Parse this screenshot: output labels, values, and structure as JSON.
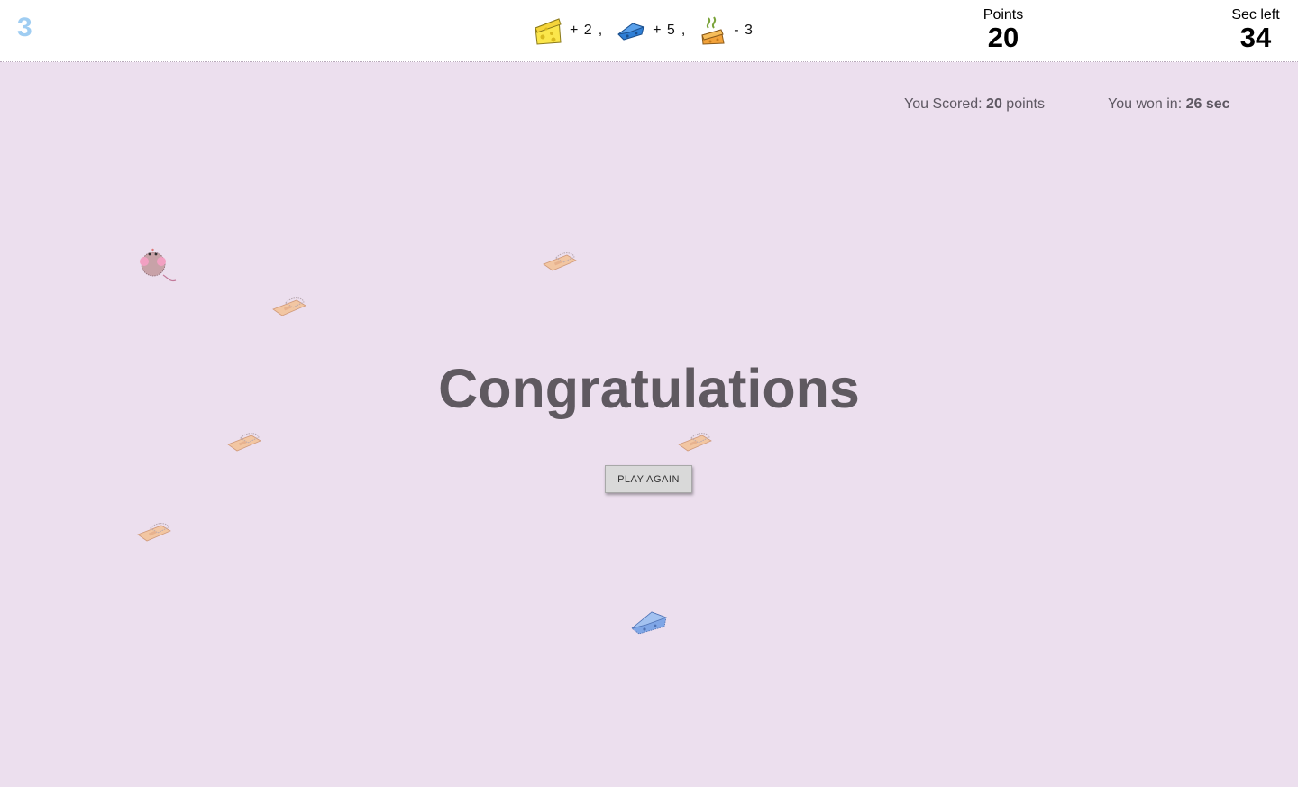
{
  "header": {
    "level": "3",
    "legend": [
      {
        "icon": "cheese-icon",
        "value": "+ 2",
        "separator": ","
      },
      {
        "icon": "blue-cheese-icon",
        "value": "+ 5",
        "separator": ","
      },
      {
        "icon": "stinky-cheese-icon",
        "value": "- 3",
        "separator": ""
      }
    ],
    "points_label": "Points",
    "points_value": "20",
    "seconds_label": "Sec left",
    "seconds_value": "34"
  },
  "result": {
    "scored_prefix": "You Scored:",
    "scored_value": "20",
    "scored_suffix": "points",
    "won_prefix": "You won in:",
    "won_value": "26 sec"
  },
  "main": {
    "title": "Congratulations",
    "play_again_label": "PLAY AGAIN"
  },
  "board": {
    "mouse": {
      "icon": "mouse-icon"
    },
    "trap_icon": "mousetrap-icon",
    "trap_count": 5,
    "blue_cheese_count": 1
  },
  "colors": {
    "background": "#ecdfee",
    "level": "#9fcdf2",
    "text": "#5f5960"
  }
}
